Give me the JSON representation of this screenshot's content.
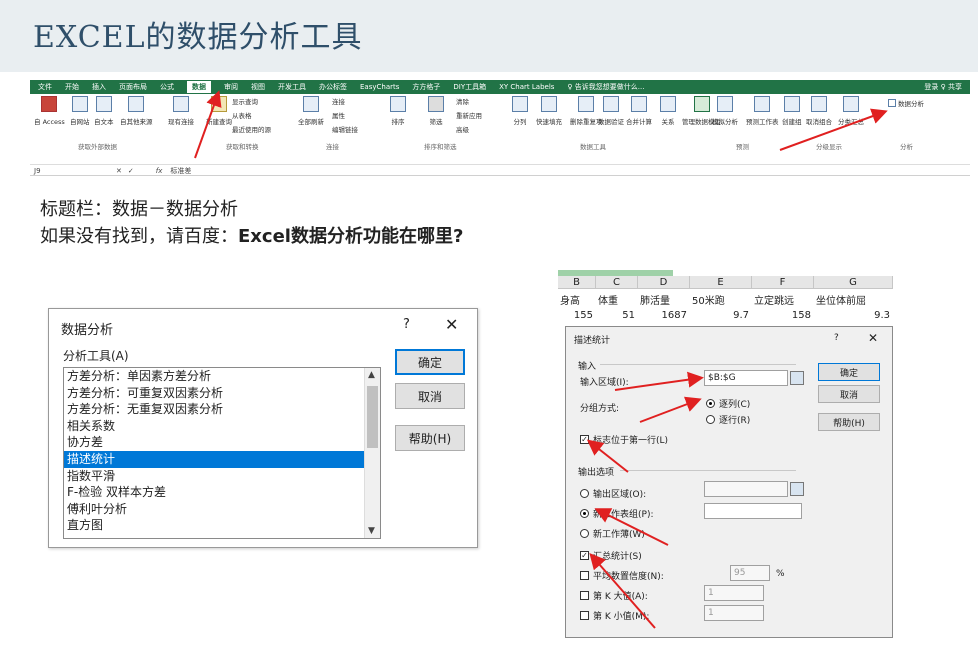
{
  "slide": {
    "title": "EXCEL的数据分析工具",
    "line1": "标题栏：数据－数据分析",
    "line2_prefix": "如果没有找到，请百度：",
    "line2_bold": "Excel数据分析功能在哪里?"
  },
  "ribbon": {
    "menu": [
      "文件",
      "开始",
      "插入",
      "页面布局",
      "公式",
      "数据",
      "审阅",
      "视图",
      "开发工具",
      "办公标签",
      "EasyCharts",
      "方方格子",
      "DIY工具箱",
      "XY Chart Labels",
      "♀ 告诉我您想要做什么..."
    ],
    "active_menu": "数据",
    "account": "登录  ♀ 共享",
    "tools": {
      "from_access": "自 Access",
      "from_web": "自网站",
      "from_text": "自文本",
      "from_other": "自其他来源",
      "existing": "现有连接",
      "new_query": "新建查询",
      "show_query": "显示查询",
      "from_table": "从表格",
      "recent": "最近使用的源",
      "refresh_all": "全部刷新",
      "connections": "连接",
      "properties": "属性",
      "edit_links": "编辑链接",
      "sort": "排序",
      "filter": "筛选",
      "clear": "清除",
      "reapply": "重新应用",
      "advanced": "高级",
      "text_to_col": "分列",
      "flash_fill": "快速填充",
      "remove_dup": "删除重复项",
      "validation": "数据验证",
      "consolidate": "合并计算",
      "relations": "关系",
      "data_model": "管理数据模型",
      "what_if": "模拟分析",
      "forecast": "预测工作表",
      "group": "创建组",
      "ungroup": "取消组合",
      "subtotal": "分类汇总",
      "data_analysis": "数据分析"
    },
    "groups": [
      "获取外部数据",
      "获取和转换",
      "连接",
      "排序和筛选",
      "数据工具",
      "预测",
      "分级显示",
      "分析"
    ],
    "cell_ref": "J9",
    "formula": "标准差"
  },
  "dialog_analysis": {
    "title": "数据分析",
    "help_q": "?",
    "close": "✕",
    "tools_label": "分析工具(A)",
    "items": [
      "方差分析：单因素方差分析",
      "方差分析：可重复双因素分析",
      "方差分析：无重复双因素分析",
      "相关系数",
      "协方差",
      "描述统计",
      "指数平滑",
      "F-检验 双样本方差",
      "傅利叶分析",
      "直方图"
    ],
    "selected": "描述统计",
    "ok": "确定",
    "cancel": "取消",
    "help": "帮助(H)"
  },
  "sheet": {
    "columns": [
      "B",
      "C",
      "D",
      "E",
      "F",
      "G"
    ],
    "headers": [
      "身高",
      "体重",
      "肺活量",
      "50米跑",
      "立定跳远",
      "坐位体前屈"
    ],
    "row1": [
      "155",
      "51",
      "1687",
      "9.7",
      "158",
      "9.3"
    ]
  },
  "dialog_desc": {
    "title": "描述统计",
    "help_q": "?",
    "close": "✕",
    "input_section": "输入",
    "input_range_label": "输入区域(I):",
    "input_range_value": "$B:$G",
    "group_by_label": "分组方式:",
    "by_column": "逐列(C)",
    "by_row": "逐行(R)",
    "labels_first_row": "标志位于第一行(L)",
    "output_section": "输出选项",
    "output_range": "输出区域(O):",
    "new_sheet": "新工作表组(P):",
    "new_workbook": "新工作薄(W)",
    "summary_stats": "汇总统计(S)",
    "confidence": "平均数置信度(N):",
    "confidence_value": "95",
    "percent": "%",
    "kth_largest": "第 K 大值(A):",
    "kth_largest_value": "1",
    "kth_smallest": "第 K 小值(M):",
    "kth_smallest_value": "1",
    "ok": "确定",
    "cancel": "取消",
    "help": "帮助(H)"
  },
  "colors": {
    "excel_green": "#217346",
    "arrow_red": "#e02020",
    "select_blue": "#0078d7",
    "title_band": "#e9eef1"
  }
}
